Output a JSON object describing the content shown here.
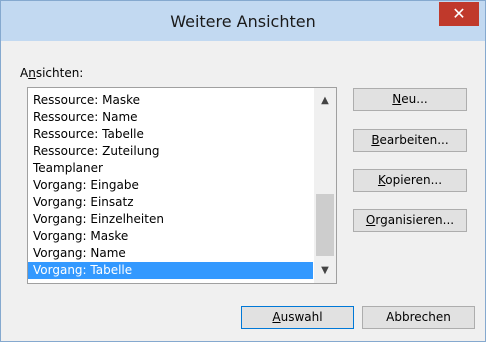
{
  "dialog": {
    "title": "Weitere Ansichten",
    "close_glyph": "✕"
  },
  "views_label": {
    "mnemonic": "n",
    "before": "A",
    "after": "sichten:"
  },
  "views": [
    "Ressource: Maske",
    "Ressource: Name",
    "Ressource: Tabelle",
    "Ressource: Zuteilung",
    "Teamplaner",
    "Vorgang: Eingabe",
    "Vorgang: Einsatz",
    "Vorgang: Einzelheiten",
    "Vorgang: Maske",
    "Vorgang: Name",
    "Vorgang: Tabelle"
  ],
  "selected_view": "Vorgang: Tabelle",
  "scroll": {
    "up_glyph": "▲",
    "down_glyph": "▼"
  },
  "buttons": {
    "new": {
      "mnemonic": "N",
      "rest": "eu..."
    },
    "edit": {
      "mnemonic": "B",
      "rest": "earbeiten..."
    },
    "copy": {
      "mnemonic": "K",
      "rest": "opieren..."
    },
    "organize": {
      "mnemonic": "O",
      "rest": "rganisieren..."
    },
    "apply": {
      "mnemonic": "A",
      "rest": "uswahl"
    },
    "cancel": {
      "label": "Abbrechen"
    }
  },
  "colors": {
    "titlebar": "#c2d9f1",
    "close": "#c0392b",
    "selection": "#3399ff",
    "default_button_border": "#0078d7"
  }
}
